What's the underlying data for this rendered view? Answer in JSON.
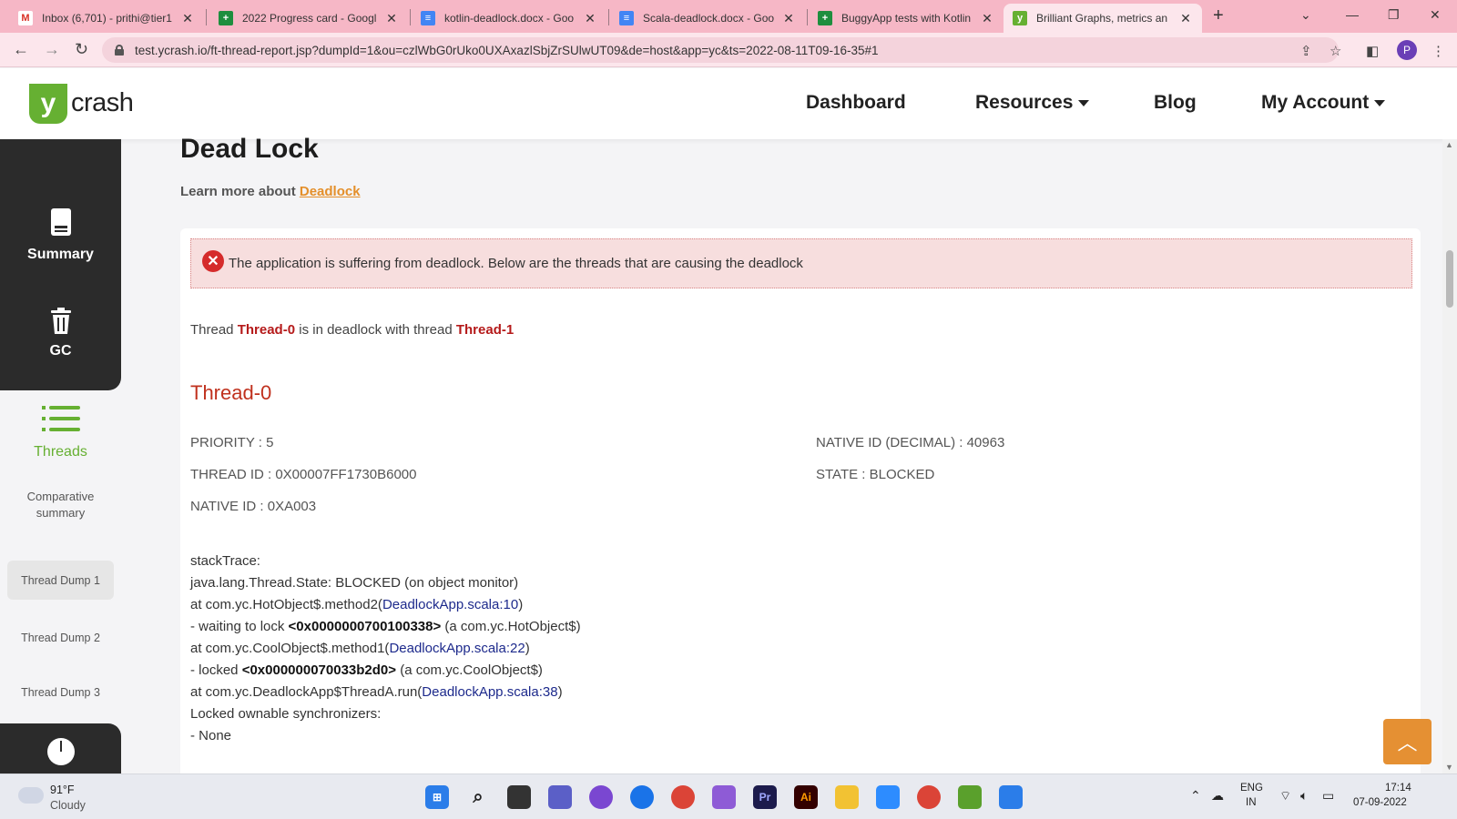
{
  "browser": {
    "tabs": [
      {
        "title": "Inbox (6,701) - prithi@tier1",
        "icon": "gmail-icon",
        "color": "#d93025",
        "glyph": "M"
      },
      {
        "title": "2022 Progress card - Googl",
        "icon": "sheets-icon",
        "color": "#1e8e3e",
        "glyph": "+"
      },
      {
        "title": "kotlin-deadlock.docx - Goo",
        "icon": "docs-icon",
        "color": "#4285f4",
        "glyph": "≡"
      },
      {
        "title": "Scala-deadlock.docx - Goo",
        "icon": "docs-icon",
        "color": "#4285f4",
        "glyph": "≡"
      },
      {
        "title": "BuggyApp tests with Kotlin",
        "icon": "sheets-icon",
        "color": "#1e8e3e",
        "glyph": "+"
      },
      {
        "title": "Brilliant Graphs, metrics an",
        "icon": "ycrash-icon",
        "color": "#66b032",
        "glyph": "y"
      }
    ],
    "url": "test.ycrash.io/ft-thread-report.jsp?dumpId=1&ou=czlWbG0rUko0UXAxazlSbjZrSUlwUT09&de=host&app=yc&ts=2022-08-11T09-16-35#1",
    "profile_initial": "P"
  },
  "site": {
    "logo_letter": "y",
    "logo_text": "crash",
    "nav": {
      "dashboard": "Dashboard",
      "resources": "Resources",
      "blog": "Blog",
      "account": "My Account"
    }
  },
  "sidebar": {
    "summary": "Summary",
    "gc": "GC",
    "threads": "Threads",
    "comparative_line1": "Comparative",
    "comparative_line2": "summary",
    "dumps": [
      "Thread Dump 1",
      "Thread Dump 2",
      "Thread Dump 3"
    ]
  },
  "content": {
    "title": "Dead Lock",
    "learn_prefix": "Learn more about",
    "learn_link": "Deadlock",
    "alert": "The application is suffering from deadlock. Below are the threads that are causing the deadlock",
    "deadlock_line": {
      "prefix": "Thread",
      "thread_a": "Thread-0",
      "middle": "is in deadlock with thread",
      "thread_b": "Thread-1"
    },
    "thread_heading": "Thread-0",
    "props": {
      "priority": "PRIORITY : 5",
      "thread_id": "THREAD ID : 0X00007FF1730B6000",
      "native_id": "NATIVE ID : 0XA003",
      "native_id_decimal": "NATIVE ID (DECIMAL) : 40963",
      "state": "STATE : BLOCKED"
    },
    "stack": {
      "label": "stackTrace:",
      "l1": "java.lang.Thread.State: BLOCKED (on object monitor)",
      "l2_pre": "at com.yc.HotObject$.method2(",
      "l2_link": "DeadlockApp.scala:10",
      "l2_post": ")",
      "l3_pre": "- waiting to lock ",
      "l3_bold": "<0x0000000700100338>",
      "l3_post": " (a com.yc.HotObject$)",
      "l4_pre": "at com.yc.CoolObject$.method1(",
      "l4_link": "DeadlockApp.scala:22",
      "l4_post": ")",
      "l5_pre": "- locked ",
      "l5_bold": "<0x000000070033b2d0>",
      "l5_post": " (a com.yc.CoolObject$)",
      "l6_pre": "at com.yc.DeadlockApp$ThreadA.run(",
      "l6_link": "DeadlockApp.scala:38",
      "l6_post": ")",
      "l7": "Locked ownable synchronizers:",
      "l8": "- None"
    }
  },
  "taskbar": {
    "temp": "91°F",
    "condition": "Cloudy",
    "lang1": "ENG",
    "lang2": "IN",
    "time": "17:14",
    "date": "07-09-2022"
  }
}
